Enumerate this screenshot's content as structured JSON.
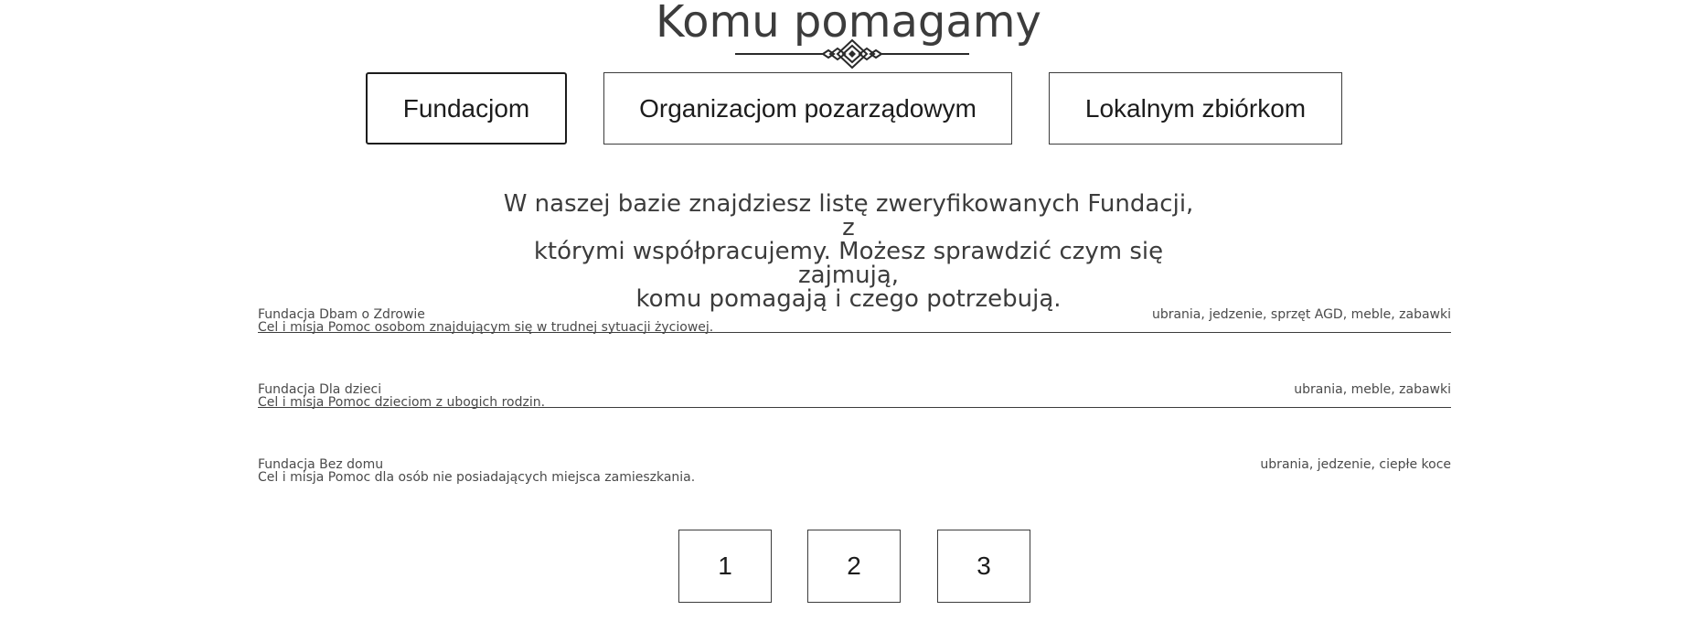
{
  "header": {
    "title": "Komu pomagamy"
  },
  "tabs": [
    {
      "label": "Fundacjom",
      "active": true
    },
    {
      "label": "Organizacjom pozarządowym",
      "active": false
    },
    {
      "label": "Lokalnym zbiórkom",
      "active": false
    }
  ],
  "description": {
    "line1": "W naszej bazie znajdziesz listę zweryfikowanych Fundacji, z",
    "line2": "którymi współpracujemy. Możesz sprawdzić czym się zajmują,",
    "line3": "komu pomagają i czego potrzebują."
  },
  "organizations": [
    {
      "name": "Fundacja Dbam o Zdrowie",
      "mission": "Cel i misja Pomoc osobom znajdującym się w trudnej sytuacji życiowej.",
      "needs": "ubrania, jedzenie, sprzęt AGD, meble, zabawki"
    },
    {
      "name": "Fundacja Dla dzieci",
      "mission": "Cel i misja Pomoc dzieciom z ubogich rodzin.",
      "needs": "ubrania, meble, zabawki"
    },
    {
      "name": "Fundacja Bez domu",
      "mission": "Cel i misja Pomoc dla osób nie posiadających miejsca zamieszkania.",
      "needs": "ubrania, jedzenie, ciepłe koce"
    }
  ],
  "pagination": {
    "pages": [
      "1",
      "2",
      "3"
    ]
  },
  "colors": {
    "text": "#3c3c3c",
    "border": "#3c3c3c",
    "background": "#ffffff"
  },
  "icons": {
    "decoration": "ornament-divider-icon"
  }
}
